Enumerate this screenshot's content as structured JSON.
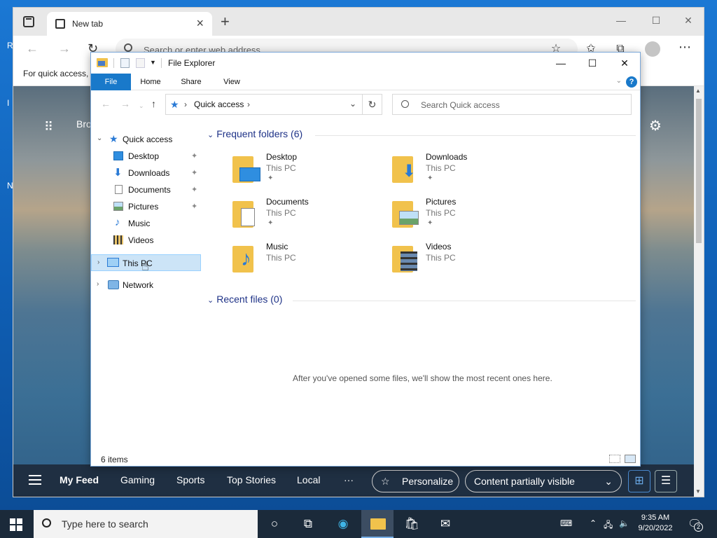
{
  "browser": {
    "tab_title": "New tab",
    "address_placeholder": "Search or enter web address",
    "favorites_bar_text": "For quick access, p",
    "content_text": "Bro",
    "feed": {
      "items": [
        "My Feed",
        "Gaming",
        "Sports",
        "Top Stories",
        "Local"
      ],
      "more": "···",
      "personalize": "Personalize",
      "content_visibility": "Content partially visible"
    }
  },
  "explorer": {
    "title": "File Explorer",
    "ribbon_tabs": [
      "File",
      "Home",
      "Share",
      "View"
    ],
    "address_crumb": "Quick access",
    "search_placeholder": "Search Quick access",
    "tree": {
      "quick_access": "Quick access",
      "quick_items": [
        "Desktop",
        "Downloads",
        "Documents",
        "Pictures",
        "Music",
        "Videos"
      ],
      "this_pc": "This PC",
      "network": "Network"
    },
    "frequent_header": "Frequent folders (6)",
    "folders": [
      {
        "name": "Desktop",
        "location": "This PC"
      },
      {
        "name": "Downloads",
        "location": "This PC"
      },
      {
        "name": "Documents",
        "location": "This PC"
      },
      {
        "name": "Pictures",
        "location": "This PC"
      },
      {
        "name": "Music",
        "location": "This PC"
      },
      {
        "name": "Videos",
        "location": "This PC"
      }
    ],
    "recent_header": "Recent files (0)",
    "recent_empty_message": "After you've opened some files, we'll show the most recent ones here.",
    "status_items": "6 items"
  },
  "taskbar": {
    "search_placeholder": "Type here to search",
    "time": "9:35 AM",
    "date": "9/20/2022",
    "notification_count": "2"
  },
  "colors": {
    "accent": "#1979ca",
    "folder_yellow": "#f1c24c",
    "section_blue": "#1e3287",
    "selection": "#cce4f7"
  }
}
